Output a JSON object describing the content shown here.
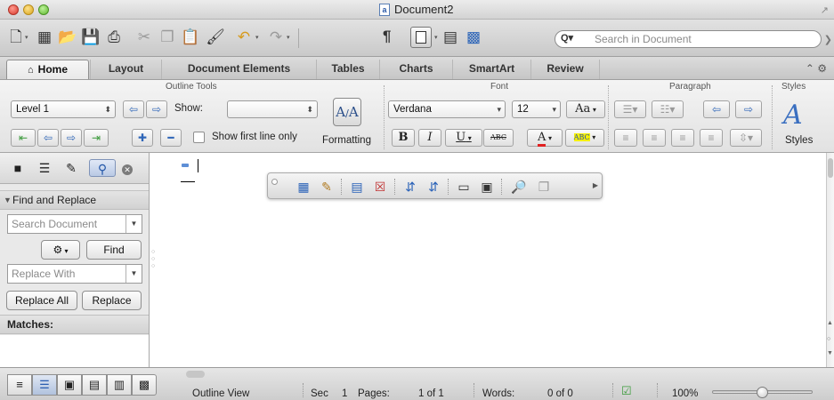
{
  "window": {
    "title": "Document2"
  },
  "search": {
    "placeholder": "Search in Document"
  },
  "ribbon_tabs": [
    {
      "label": "Home"
    },
    {
      "label": "Layout"
    },
    {
      "label": "Document Elements"
    },
    {
      "label": "Tables"
    },
    {
      "label": "Charts"
    },
    {
      "label": "SmartArt"
    },
    {
      "label": "Review"
    }
  ],
  "groups": {
    "outline_tools": "Outline Tools",
    "font": "Font",
    "paragraph": "Paragraph",
    "styles": "Styles"
  },
  "outline_tools": {
    "level_value": "Level 1",
    "show_label": "Show:",
    "show_value": "",
    "show_first_line_label": "Show first line only",
    "formatting_label": "Formatting"
  },
  "font": {
    "name": "Verdana",
    "size": "12",
    "bold": "B",
    "italic": "I",
    "underline": "U",
    "strike": "ABC",
    "font_color": "A",
    "highlight": "ABC",
    "grow": "Aa"
  },
  "styles": {
    "label": "Styles"
  },
  "sidebar": {
    "header": "Find and Replace",
    "search_placeholder": "Search Document",
    "find_label": "Find",
    "replace_placeholder": "Replace With",
    "replace_all_label": "Replace All",
    "replace_label": "Replace",
    "matches_label": "Matches:"
  },
  "status": {
    "view": "Outline View",
    "sec_label": "Sec",
    "sec_value": "1",
    "pages_label": "Pages:",
    "pages_value": "1 of 1",
    "words_label": "Words:",
    "words_value": "0 of 0",
    "zoom": "100%",
    "zoom_fraction": 0.5
  },
  "colors": {
    "accent": "#2f66b8",
    "font_color_bar": "#e02020",
    "highlight_bar": "#f5f000",
    "status_ok": "#3c9c3c"
  }
}
